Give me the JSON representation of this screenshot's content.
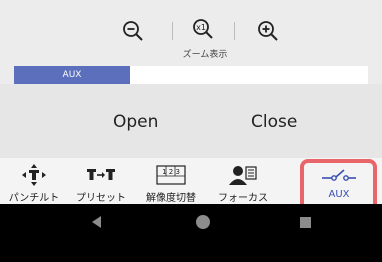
{
  "zoom": {
    "label": "ズーム表示",
    "zoom_out_icon": "zoom-out-icon",
    "zoom_reset_icon": "zoom-reset-icon",
    "zoom_reset_glyph": "x1",
    "zoom_in_icon": "zoom-in-icon"
  },
  "tabs": {
    "active_label": "AUX",
    "active_color": "#5b6fbd"
  },
  "aux": {
    "open_label": "Open",
    "close_label": "Close"
  },
  "bottom_nav": {
    "items": [
      {
        "label": "パンチルト",
        "icon": "pan-tilt-icon"
      },
      {
        "label": "プリセット",
        "icon": "preset-icon"
      },
      {
        "label": "解像度切替",
        "icon": "resolution-switch-icon",
        "icon_text": "1 2 3"
      },
      {
        "label": "フォーカス",
        "icon": "focus-icon"
      },
      {
        "label": "AUX",
        "icon": "aux-switch-icon"
      }
    ],
    "selected": "AUX",
    "selected_color": "#3b4fb0",
    "highlight_color": "#e8666a"
  },
  "system_nav": {
    "back_icon": "back-icon",
    "home_icon": "home-icon",
    "recent_icon": "recent-apps-icon"
  }
}
